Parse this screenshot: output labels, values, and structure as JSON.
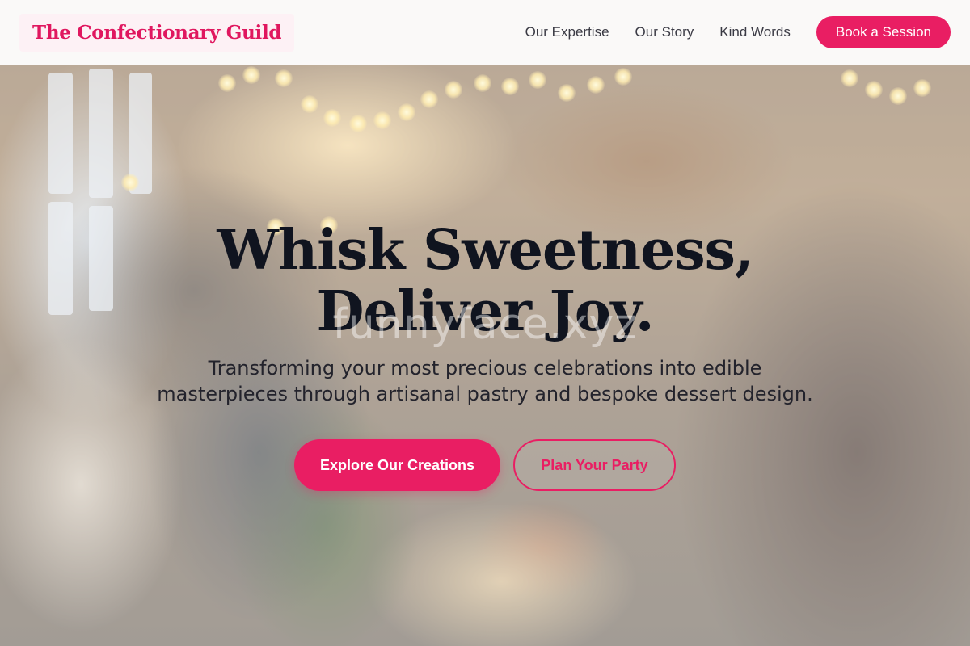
{
  "header": {
    "logo": "The Confectionary Guild",
    "nav": [
      "Our Expertise",
      "Our Story",
      "Kind Words"
    ],
    "cta_label": "Book a Session"
  },
  "hero": {
    "title": "Whisk Sweetness, Deliver Joy.",
    "subtitle": "Transforming your most precious celebrations into edible masterpieces through artisanal pastry and bespoke dessert design.",
    "primary_cta": "Explore Our Creations",
    "secondary_cta": "Plan Your Party",
    "watermark": "funnyface.xyz"
  },
  "colors": {
    "accent": "#e91e63",
    "title": "#10141f",
    "text": "#23232c"
  }
}
